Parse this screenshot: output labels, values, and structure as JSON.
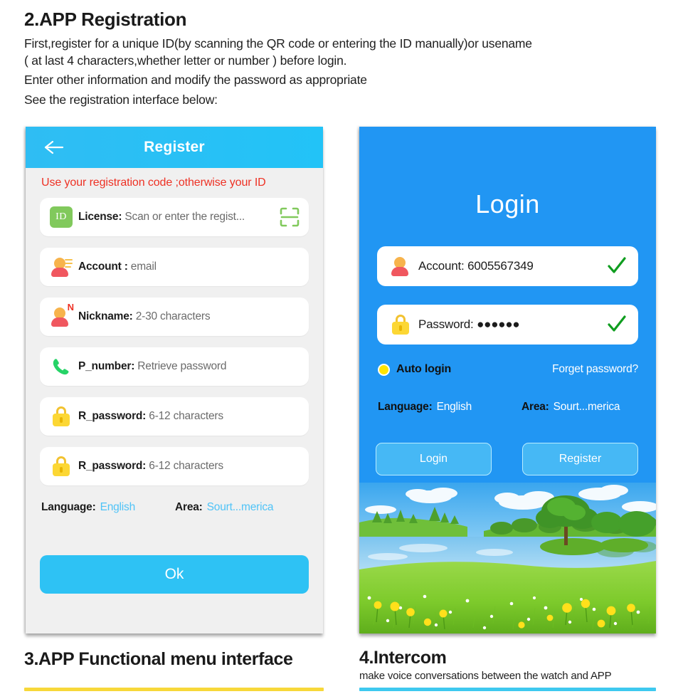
{
  "intro": {
    "heading": "2.APP Registration",
    "line1": "First,register for a unique ID(by scanning the QR code or entering the ID manually)or usename",
    "line2": "( at last 4 characters,whether letter or number ) before login.",
    "line3": "Enter other information and modify the password as appropriate",
    "line4": "See the registration interface below:"
  },
  "register_screen": {
    "back_icon": "back-arrow-icon",
    "title": "Register",
    "warning": "Use your registration code ;otherwise your ID",
    "fields": [
      {
        "icon": "id-badge-icon",
        "icon_text": "ID",
        "label": "License:",
        "value": "Scan or enter the regist...",
        "trailing_icon": "qr-scan-icon"
      },
      {
        "icon": "account-person-icon",
        "label": "Account :",
        "value": "email"
      },
      {
        "icon": "nickname-person-icon",
        "icon_text": "N",
        "label": "Nickname:",
        "value": "2-30 characters"
      },
      {
        "icon": "phone-handset-icon",
        "label": "P_number:",
        "value": "Retrieve password"
      },
      {
        "icon": "lock-icon",
        "label": "R_password:",
        "value": "6-12 characters"
      },
      {
        "icon": "lock-icon",
        "label": "R_password:",
        "value": "6-12 characters"
      }
    ],
    "language_label": "Language:",
    "language_value": "English",
    "area_label": "Area:",
    "area_value": "Sourt...merica",
    "ok_label": "Ok"
  },
  "login_screen": {
    "title": "Login",
    "account_icon": "account-person-icon",
    "account_text": "Account: 6005567349",
    "account_check_icon": "green-check-icon",
    "password_icon": "lock-icon",
    "password_text": "Password: ●●●●●●",
    "password_check_icon": "green-check-icon",
    "auto_login_label": "Auto login",
    "auto_login_radio": "radio-selected-icon",
    "forget_password_label": "Forget password?",
    "language_label": "Language:",
    "language_value": "English",
    "area_label": "Area:",
    "area_value": "Sourt...merica",
    "login_button": "Login",
    "register_button": "Register"
  },
  "sections": {
    "section3_heading": "3.APP Functional menu interface",
    "section4_heading": "4.Intercom",
    "section4_sub": "make voice conversations between the watch and APP"
  },
  "colors": {
    "header_blue": "#29c0f5",
    "login_blue": "#2196f3",
    "accent_button": "#2ec2f4",
    "warning_red": "#ee3124",
    "link_blue": "#4fc3f7",
    "rule_yellow": "#f7d83a",
    "rule_cyan": "#3ec9ef",
    "lock_yellow": "#fcd734",
    "check_green": "#0f9d1f",
    "id_green": "#81c95c",
    "radio_yellow": "#ffe500"
  }
}
